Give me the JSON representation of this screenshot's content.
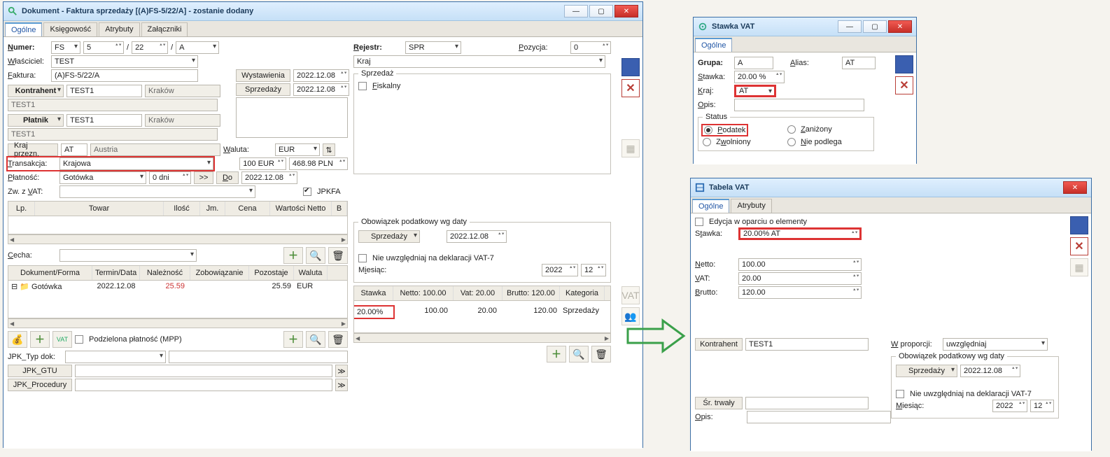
{
  "win1": {
    "title": "Dokument - Faktura sprzedaży [(A)FS-5/22/A]  - zostanie dodany",
    "tabs": [
      "Ogólne",
      "Księgowość",
      "Atrybuty",
      "Załączniki"
    ],
    "labels": {
      "numer": "Numer:",
      "wlasciciel": "Właściciel:",
      "faktura": "Faktura:",
      "kontrahent": "Kontrahent",
      "platnik": "Płatnik",
      "kraj_przezn": "Kraj przezn.",
      "transakcja": "Transakcja:",
      "platnosc": "Płatność:",
      "zw_z_vat": "Zw. z VAT:",
      "waluta": "Waluta:",
      "rejestr": "Rejestr:",
      "pozycja": "Pozycja:",
      "wystawienia": "Wystawienia",
      "sprzedazy": "Sprzedaży",
      "do": "Do",
      "jpkfa": "JPKFA",
      "cecha": "Cecha:",
      "jpk_typ_dok": "JPK_Typ dok:",
      "jpk_gtu": "JPK_GTU",
      "jpk_procedury": "JPK_Procedury",
      "podzielona": "Podzielona płatność (MPP)",
      "kraj": "Kraj",
      "sprzedaz": "Sprzedaż",
      "fiskalny": "Fiskalny",
      "obowiazek": "Obowiązek podatkowy wg daty",
      "nie_uwzgledniaj": "Nie uwzględniaj na deklaracji VAT-7",
      "miesiac": "Miesiąc:"
    },
    "values": {
      "numer_prefix": "FS",
      "numer_seq": "5",
      "numer_slash": "/",
      "numer_year": "22",
      "numer_suffix": "A",
      "wlasciciel": "TEST",
      "faktura": "(A)FS-5/22/A",
      "kontrahent_code": "TEST1",
      "kontrahent_city": "Kraków",
      "kontrahent_name": "TEST1",
      "platnik_code": "TEST1",
      "platnik_city": "Kraków",
      "platnik_name": "TEST1",
      "kraj_przezn_code": "AT",
      "kraj_przezn_name": "Austria",
      "transakcja": "Krajowa",
      "platnosc": "Gotówka",
      "platnosc_dni": "0 dni",
      "zw_z_vat": "",
      "waluta": "EUR",
      "waluta_rate1": "100 EUR",
      "waluta_rate2": "468.98 PLN",
      "rejestr": "SPR",
      "pozycja": "0",
      "wystawienia": "2022.12.08",
      "sprzedazy": "2022.12.08",
      "do_date": "2022.12.08",
      "sprzedazy2": "Sprzedaży",
      "sprzedazy2_date": "2022.12.08",
      "miesiac_rok": "2022",
      "miesiac_m": "12",
      "arrows": ">>"
    },
    "items_grid": {
      "headers": [
        "Lp.",
        "Towar",
        "Ilość",
        "Jm.",
        "Cena",
        "Wartości Netto",
        "B"
      ]
    },
    "payments_grid": {
      "headers": [
        "Dokument/Forma",
        "Termin/Data",
        "Należność",
        "Zobowiązanie",
        "Pozostaje",
        "Waluta"
      ],
      "row": {
        "forma_icon": "📁",
        "forma": "Gotówka",
        "data": "2022.12.08",
        "naleznosc": "25.59",
        "zobow": "",
        "pozostaje": "25.59",
        "waluta": "EUR"
      }
    },
    "vat_grid": {
      "headers": [
        "Stawka",
        "Netto: 100.00",
        "Vat: 20.00",
        "Brutto: 120.00",
        "Kategoria"
      ],
      "row": {
        "stawka": "20.00%",
        "netto": "100.00",
        "vat": "20.00",
        "brutto": "120.00",
        "kategoria": "Sprzedaży"
      }
    }
  },
  "win2": {
    "title": "Stawka VAT",
    "tab": "Ogólne",
    "labels": {
      "grupa": "Grupa:",
      "alias": "Alias:",
      "stawka": "Stawka:",
      "kraj": "Kraj:",
      "opis": "Opis:",
      "status": "Status",
      "podatek": "Podatek",
      "zanizony": "Zaniżony",
      "zwolniony": "Zwolniony",
      "nie_podlega": "Nie podlega"
    },
    "values": {
      "grupa": "A",
      "alias": "AT",
      "stawka": "20.00 %",
      "kraj": "AT",
      "opis": ""
    }
  },
  "win3": {
    "title": "Tabela VAT",
    "tabs": [
      "Ogólne",
      "Atrybuty"
    ],
    "labels": {
      "edycja": "Edycja w oparciu o elementy",
      "stawka": "Stawka:",
      "netto": "Netto:",
      "vat": "VAT:",
      "brutto": "Brutto:",
      "kontrahent": "Kontrahent",
      "sr_trwaly": "Śr. trwały",
      "opis": "Opis:",
      "w_proporcji": "W proporcji:",
      "obowiazek": "Obowiązek podatkowy wg daty",
      "nie_uwz": "Nie uwzględniaj na deklaracji VAT-7",
      "miesiac": "Miesiąc:"
    },
    "values": {
      "stawka": "20.00% AT",
      "netto": "100.00",
      "vat": "20.00",
      "brutto": "120.00",
      "kontrahent": "TEST1",
      "sr_trwaly": "",
      "w_proporcji": "uwzględniaj",
      "sprzedazy": "Sprzedaży",
      "sprzedazy_date": "2022.12.08",
      "miesiac_rok": "2022",
      "miesiac_m": "12",
      "opis": ""
    }
  }
}
